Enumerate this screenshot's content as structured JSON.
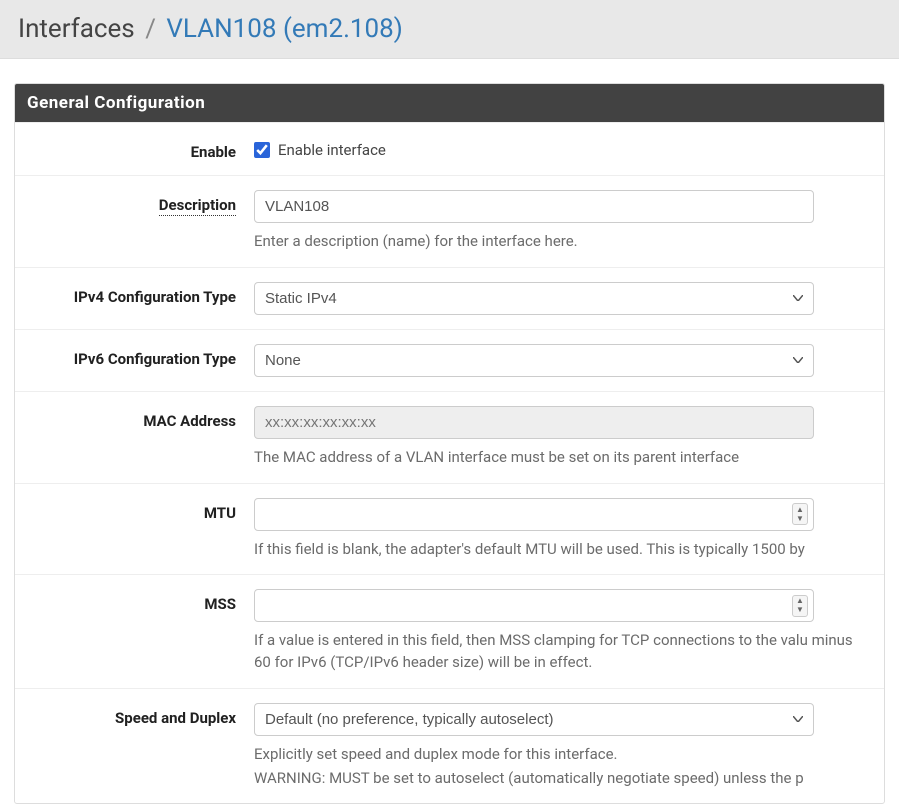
{
  "breadcrumb": {
    "root": "Interfaces",
    "current": "VLAN108 (em2.108)"
  },
  "panel": {
    "title": "General Configuration"
  },
  "fields": {
    "enable": {
      "label": "Enable",
      "checkbox_label": "Enable interface",
      "checked": true
    },
    "description": {
      "label": "Description",
      "value": "VLAN108",
      "help": "Enter a description (name) for the interface here."
    },
    "ipv4type": {
      "label": "IPv4 Configuration Type",
      "value": "Static IPv4"
    },
    "ipv6type": {
      "label": "IPv6 Configuration Type",
      "value": "None"
    },
    "mac": {
      "label": "MAC Address",
      "placeholder": "xx:xx:xx:xx:xx:xx",
      "help": "The MAC address of a VLAN interface must be set on its parent interface"
    },
    "mtu": {
      "label": "MTU",
      "value": "",
      "help": "If this field is blank, the adapter's default MTU will be used. This is typically 1500 by"
    },
    "mss": {
      "label": "MSS",
      "value": "",
      "help": "If a value is entered in this field, then MSS clamping for TCP connections to the valu minus 60 for IPv6 (TCP/IPv6 header size) will be in effect."
    },
    "speed": {
      "label": "Speed and Duplex",
      "value": "Default (no preference, typically autoselect)",
      "help1": "Explicitly set speed and duplex mode for this interface.",
      "help2": "WARNING: MUST be set to autoselect (automatically negotiate speed) unless the p"
    }
  }
}
